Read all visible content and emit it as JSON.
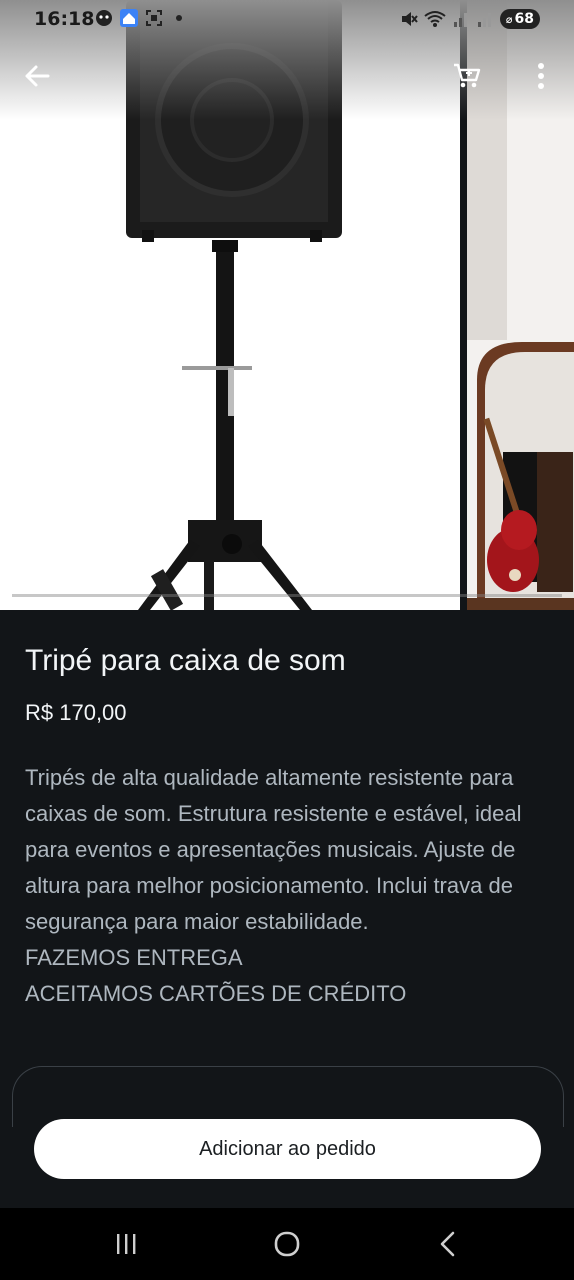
{
  "status_bar": {
    "time": "16:18",
    "battery": "68",
    "left_icons": [
      "face-icon",
      "home-app-icon",
      "screenshot-icon",
      "dot-icon"
    ],
    "right_icons": [
      "mute-icon",
      "wifi-icon",
      "signal-icon",
      "signal-icon",
      "battery-icon"
    ]
  },
  "app_bar": {
    "back_icon": "arrow-left-icon",
    "cart_icon": "cart-icon",
    "more_icon": "more-vertical-icon"
  },
  "product": {
    "title": "Tripé para caixa de som",
    "price": "R$ 170,00",
    "description_lines": [
      "Tripés de alta qualidade altamente resistente para caixas de som.  Estrutura resistente e estável, ideal para eventos e apresentações musicais. Ajuste de altura para melhor posicionamento. Inclui trava de segurança para maior estabilidade.",
      "FAZEMOS ENTREGA",
      "ACEITAMOS CARTÕES DE CRÉDITO"
    ]
  },
  "actions": {
    "add_to_order": "Adicionar ao pedido"
  },
  "nav_bar": {
    "recents_icon": "recents-icon",
    "home_icon": "home-circle-icon",
    "back_icon": "chevron-left-icon"
  },
  "colors": {
    "background": "#121518",
    "button_bg": "#ffffff",
    "text_primary": "#f2f5f7",
    "text_secondary": "#aeb7bf"
  }
}
